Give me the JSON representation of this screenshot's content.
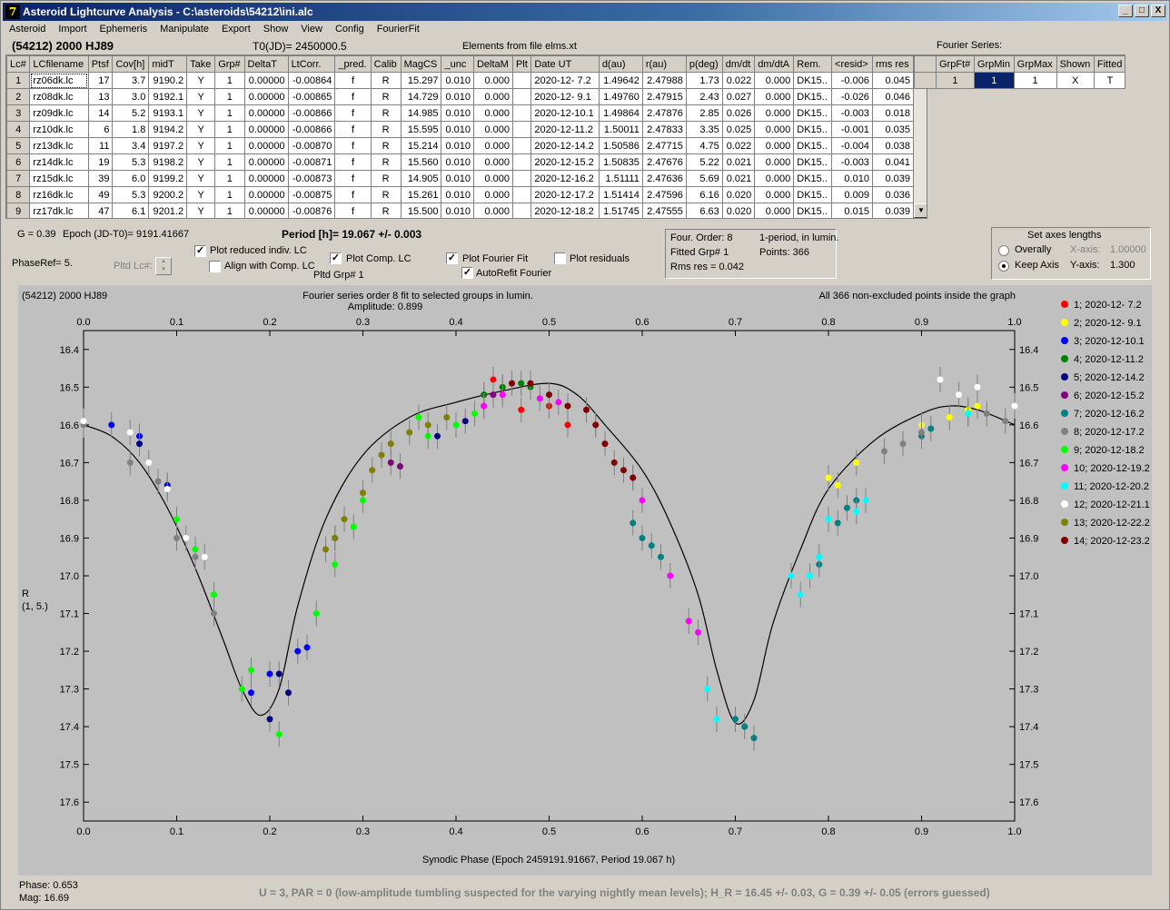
{
  "window": {
    "title": "Asteroid Lightcurve Analysis - C:\\asteroids\\54212\\ini.alc",
    "icon_glyph": "7",
    "min_glyph": "_",
    "max_glyph": "□",
    "close_glyph": "X"
  },
  "menu": [
    "Asteroid",
    "Import",
    "Ephemeris",
    "Manipulate",
    "Export",
    "Show",
    "View",
    "Config",
    "FourierFit"
  ],
  "header": {
    "object": "(54212) 2000 HJ89",
    "t0": "T0(JD)= 2450000.5",
    "elements": "Elements from file elms.xt"
  },
  "lc_table": {
    "columns": [
      "Lc#",
      "LCfilename",
      "Ptsf",
      "Cov[h]",
      "midT",
      "Take",
      "Grp#",
      "DeltaT",
      "LtCorr.",
      "_pred.",
      "Calib",
      "MagCS",
      "_unc",
      "DeltaM",
      "Plt",
      "Date UT",
      "d(au)",
      "r(au)",
      "p(deg)",
      "dm/dt",
      "dm/dtA",
      "Rem.",
      "<resid>",
      "rms res"
    ],
    "rows": [
      [
        "1",
        "rz06dk.lc",
        "17",
        "3.7",
        "9190.2",
        "Y",
        "1",
        "0.00000",
        "-0.00864",
        "f",
        "R",
        "15.297",
        "0.010",
        "0.000",
        "",
        "2020-12- 7.2",
        "1.49642",
        "2.47988",
        "1.73",
        "0.022",
        "0.000",
        "DK15..",
        "-0.006",
        "0.045"
      ],
      [
        "2",
        "rz08dk.lc",
        "13",
        "3.0",
        "9192.1",
        "Y",
        "1",
        "0.00000",
        "-0.00865",
        "f",
        "R",
        "14.729",
        "0.010",
        "0.000",
        "",
        "2020-12- 9.1",
        "1.49760",
        "2.47915",
        "2.43",
        "0.027",
        "0.000",
        "DK15..",
        "-0.026",
        "0.046"
      ],
      [
        "3",
        "rz09dk.lc",
        "14",
        "5.2",
        "9193.1",
        "Y",
        "1",
        "0.00000",
        "-0.00866",
        "f",
        "R",
        "14.985",
        "0.010",
        "0.000",
        "",
        "2020-12-10.1",
        "1.49864",
        "2.47876",
        "2.85",
        "0.026",
        "0.000",
        "DK15..",
        "-0.003",
        "0.018"
      ],
      [
        "4",
        "rz10dk.lc",
        "6",
        "1.8",
        "9194.2",
        "Y",
        "1",
        "0.00000",
        "-0.00866",
        "f",
        "R",
        "15.595",
        "0.010",
        "0.000",
        "",
        "2020-12-11.2",
        "1.50011",
        "2.47833",
        "3.35",
        "0.025",
        "0.000",
        "DK15..",
        "-0.001",
        "0.035"
      ],
      [
        "5",
        "rz13dk.lc",
        "11",
        "3.4",
        "9197.2",
        "Y",
        "1",
        "0.00000",
        "-0.00870",
        "f",
        "R",
        "15.214",
        "0.010",
        "0.000",
        "",
        "2020-12-14.2",
        "1.50586",
        "2.47715",
        "4.75",
        "0.022",
        "0.000",
        "DK15..",
        "-0.004",
        "0.038"
      ],
      [
        "6",
        "rz14dk.lc",
        "19",
        "5.3",
        "9198.2",
        "Y",
        "1",
        "0.00000",
        "-0.00871",
        "f",
        "R",
        "15.560",
        "0.010",
        "0.000",
        "",
        "2020-12-15.2",
        "1.50835",
        "2.47676",
        "5.22",
        "0.021",
        "0.000",
        "DK15..",
        "-0.003",
        "0.041"
      ],
      [
        "7",
        "rz15dk.lc",
        "39",
        "6.0",
        "9199.2",
        "Y",
        "1",
        "0.00000",
        "-0.00873",
        "f",
        "R",
        "14.905",
        "0.010",
        "0.000",
        "",
        "2020-12-16.2",
        "1.51111",
        "2.47636",
        "5.69",
        "0.021",
        "0.000",
        "DK15..",
        "0.010",
        "0.039"
      ],
      [
        "8",
        "rz16dk.lc",
        "49",
        "5.3",
        "9200.2",
        "Y",
        "1",
        "0.00000",
        "-0.00875",
        "f",
        "R",
        "15.261",
        "0.010",
        "0.000",
        "",
        "2020-12-17.2",
        "1.51414",
        "2.47596",
        "6.16",
        "0.020",
        "0.000",
        "DK15..",
        "0.009",
        "0.036"
      ],
      [
        "9",
        "rz17dk.lc",
        "47",
        "6.1",
        "9201.2",
        "Y",
        "1",
        "0.00000",
        "-0.00876",
        "f",
        "R",
        "15.500",
        "0.010",
        "0.000",
        "",
        "2020-12-18.2",
        "1.51745",
        "2.47555",
        "6.63",
        "0.020",
        "0.000",
        "DK15..",
        "0.015",
        "0.039"
      ]
    ]
  },
  "fourier_series": {
    "label": "Fourier Series:",
    "columns": [
      "GrpFt#",
      "GrpMin",
      "GrpMax",
      "Shown",
      "Fitted"
    ],
    "row": [
      "1",
      "1",
      "1",
      "X",
      "T"
    ]
  },
  "controls": {
    "g": "G = 0.39",
    "epoch": "Epoch (JD-T0)= 9191.41667",
    "period": "Period [h]= 19.067 +/- 0.003",
    "phaseref": "PhaseRef= 5.",
    "pltd_lc": "Pltd Lc#:",
    "plot_reduced": "Plot reduced indiv. LC",
    "align_comp": "Align with Comp. LC",
    "plot_comp": "Plot Comp. LC",
    "pltd_grp": "Pltd Grp#  1",
    "plot_fourier": "Plot Fourier Fit",
    "autorefit": "AutoRefit Fourier",
    "plot_residuals": "Plot residuals",
    "check_mark": "✓"
  },
  "fourier_info": {
    "order": "Four. Order:  8",
    "period_mode": "1-period, in lumin.",
    "fitted": "Fitted Grp# 1",
    "points": "Points: 366",
    "rms": "Rms res     = 0.042"
  },
  "axes_panel": {
    "title": "Set axes lengths",
    "overally": "Overally",
    "keep": "Keep Axis",
    "xaxis_label": "X-axis:",
    "xaxis_value": "1.00000",
    "yaxis_label": "Y-axis:",
    "yaxis_value": "1.300"
  },
  "plot": {
    "object": "(54212) 2000 HJ89",
    "fit_title": "Fourier series order 8 fit to selected groups in lumin.",
    "amplitude": "Amplitude: 0.899",
    "points_note": "All 366 non-excluded points inside the graph",
    "ylabel_1": "R",
    "ylabel_2": "(1, 5.)",
    "xlabel": "Synodic Phase (Epoch 2459191.91667, Period 19.067 h)",
    "phase": "Phase:  0.653",
    "mag": "Mag:    16.69",
    "status": "U = 3, PAR = 0 (low-amplitude tumbling suspected for the varying nightly mean levels); H_R = 16.45 +/- 0.03, G = 0.39 +/- 0.05 (errors guessed)",
    "legend": [
      {
        "label": "1; 2020-12- 7.2",
        "color": "#ff0000"
      },
      {
        "label": "2; 2020-12- 9.1",
        "color": "#ffff00"
      },
      {
        "label": "3; 2020-12-10.1",
        "color": "#0000ff"
      },
      {
        "label": "4; 2020-12-11.2",
        "color": "#008000"
      },
      {
        "label": "5; 2020-12-14.2",
        "color": "#000080"
      },
      {
        "label": "6; 2020-12-15.2",
        "color": "#800080"
      },
      {
        "label": "7; 2020-12-16.2",
        "color": "#008080"
      },
      {
        "label": "8; 2020-12-17.2",
        "color": "#808080"
      },
      {
        "label": "9; 2020-12-18.2",
        "color": "#00ff00"
      },
      {
        "label": "10; 2020-12-19.2",
        "color": "#ff00ff"
      },
      {
        "label": "11; 2020-12-20.2",
        "color": "#00ffff"
      },
      {
        "label": "12; 2020-12-21.1",
        "color": "#ffffff"
      },
      {
        "label": "13; 2020-12-22.2",
        "color": "#808000"
      },
      {
        "label": "14; 2020-12-23.2",
        "color": "#800000"
      }
    ]
  },
  "chart_data": {
    "type": "scatter",
    "xlim": [
      0.0,
      1.0
    ],
    "ylim": [
      17.65,
      16.35
    ],
    "x_ticks": [
      "0.0",
      "0.1",
      "0.2",
      "0.3",
      "0.4",
      "0.5",
      "0.6",
      "0.7",
      "0.8",
      "0.9",
      "1.0"
    ],
    "y_ticks": [
      "16.4",
      "16.5",
      "16.6",
      "16.7",
      "16.8",
      "16.9",
      "17.0",
      "17.1",
      "17.2",
      "17.3",
      "17.4",
      "17.5",
      "17.6"
    ],
    "y_inverted": true,
    "grid": false,
    "fit_curve": {
      "x": [
        0.0,
        0.03,
        0.06,
        0.09,
        0.12,
        0.15,
        0.17,
        0.19,
        0.21,
        0.23,
        0.26,
        0.3,
        0.35,
        0.4,
        0.45,
        0.5,
        0.53,
        0.56,
        0.6,
        0.63,
        0.66,
        0.68,
        0.7,
        0.72,
        0.74,
        0.77,
        0.8,
        0.85,
        0.9,
        0.93,
        0.96,
        1.0
      ],
      "y": [
        16.6,
        16.63,
        16.7,
        16.82,
        16.98,
        17.17,
        17.3,
        17.37,
        17.3,
        17.08,
        16.85,
        16.68,
        16.58,
        16.54,
        16.51,
        16.49,
        16.52,
        16.6,
        16.72,
        16.86,
        17.05,
        17.25,
        17.39,
        17.33,
        17.13,
        16.93,
        16.77,
        16.64,
        16.57,
        16.55,
        16.56,
        16.6
      ]
    },
    "series": [
      {
        "name": "1; 2020-12- 7.2",
        "x": [
          0.43,
          0.45,
          0.47,
          0.5,
          0.52,
          0.44
        ],
        "y": [
          16.52,
          16.5,
          16.56,
          16.55,
          16.6,
          16.48
        ]
      },
      {
        "name": "2; 2020-12- 9.1",
        "x": [
          0.8,
          0.81,
          0.83,
          0.9,
          0.93,
          0.95,
          0.96
        ],
        "y": [
          16.74,
          16.76,
          16.7,
          16.6,
          16.58,
          16.56,
          16.55
        ]
      },
      {
        "name": "3; 2020-12-10.1",
        "x": [
          0.03,
          0.06,
          0.09,
          0.18,
          0.2,
          0.23,
          0.24
        ],
        "y": [
          16.6,
          16.63,
          16.76,
          17.31,
          17.26,
          17.2,
          17.19
        ]
      },
      {
        "name": "4; 2020-12-11.2",
        "x": [
          0.43,
          0.45,
          0.47,
          0.48
        ],
        "y": [
          16.52,
          16.5,
          16.49,
          16.5
        ]
      },
      {
        "name": "5; 2020-12-14.2",
        "x": [
          0.06,
          0.2,
          0.21,
          0.22,
          0.27,
          0.38,
          0.41
        ],
        "y": [
          16.65,
          17.38,
          17.26,
          17.31,
          16.9,
          16.63,
          16.59
        ]
      },
      {
        "name": "6; 2020-12-15.2",
        "x": [
          0.43,
          0.44,
          0.33,
          0.34
        ],
        "y": [
          16.55,
          16.52,
          16.7,
          16.71
        ]
      },
      {
        "name": "7; 2020-12-16.2",
        "x": [
          0.59,
          0.6,
          0.61,
          0.62,
          0.7,
          0.71,
          0.72,
          0.79,
          0.81,
          0.82,
          0.83,
          0.9,
          0.91
        ],
        "y": [
          16.86,
          16.9,
          16.92,
          16.95,
          17.38,
          17.4,
          17.43,
          16.97,
          16.86,
          16.82,
          16.8,
          16.63,
          16.61
        ]
      },
      {
        "name": "8; 2020-12-17.2",
        "x": [
          0.0,
          0.05,
          0.08,
          0.1,
          0.12,
          0.14,
          0.86,
          0.88,
          0.9,
          0.95,
          0.97,
          0.99
        ],
        "y": [
          16.6,
          16.7,
          16.75,
          16.9,
          16.95,
          17.1,
          16.67,
          16.65,
          16.62,
          16.57,
          16.57,
          16.59
        ]
      },
      {
        "name": "9; 2020-12-18.2",
        "x": [
          0.1,
          0.12,
          0.14,
          0.17,
          0.18,
          0.21,
          0.25,
          0.27,
          0.29,
          0.3,
          0.36,
          0.37,
          0.4,
          0.42
        ],
        "y": [
          16.85,
          16.93,
          17.05,
          17.3,
          17.25,
          17.42,
          17.1,
          16.97,
          16.87,
          16.8,
          16.58,
          16.63,
          16.6,
          16.57
        ]
      },
      {
        "name": "10; 2020-12-19.2",
        "x": [
          0.43,
          0.45,
          0.49,
          0.51,
          0.55,
          0.59,
          0.6,
          0.63,
          0.65,
          0.66
        ],
        "y": [
          16.55,
          16.52,
          16.53,
          16.54,
          16.6,
          16.74,
          16.8,
          17.0,
          17.12,
          17.15
        ]
      },
      {
        "name": "11; 2020-12-20.2",
        "x": [
          0.67,
          0.68,
          0.76,
          0.77,
          0.78,
          0.79,
          0.8,
          0.83,
          0.84,
          0.95
        ],
        "y": [
          17.3,
          17.38,
          17.0,
          17.05,
          17.0,
          16.95,
          16.85,
          16.83,
          16.8,
          16.57
        ]
      },
      {
        "name": "12; 2020-12-21.1",
        "x": [
          0.0,
          0.05,
          0.07,
          0.09,
          0.11,
          0.13,
          0.92,
          0.94,
          0.96,
          1.0
        ],
        "y": [
          16.59,
          16.62,
          16.7,
          16.77,
          16.9,
          16.95,
          16.48,
          16.52,
          16.5,
          16.55
        ]
      },
      {
        "name": "13; 2020-12-22.2",
        "x": [
          0.26,
          0.27,
          0.28,
          0.3,
          0.31,
          0.32,
          0.33,
          0.35,
          0.37,
          0.39
        ],
        "y": [
          16.93,
          16.9,
          16.85,
          16.78,
          16.72,
          16.68,
          16.65,
          16.62,
          16.6,
          16.58
        ]
      },
      {
        "name": "14; 2020-12-23.2",
        "x": [
          0.46,
          0.48,
          0.5,
          0.52,
          0.54,
          0.55,
          0.56,
          0.57,
          0.58,
          0.59
        ],
        "y": [
          16.49,
          16.49,
          16.52,
          16.55,
          16.56,
          16.6,
          16.65,
          16.7,
          16.72,
          16.74
        ]
      }
    ]
  }
}
